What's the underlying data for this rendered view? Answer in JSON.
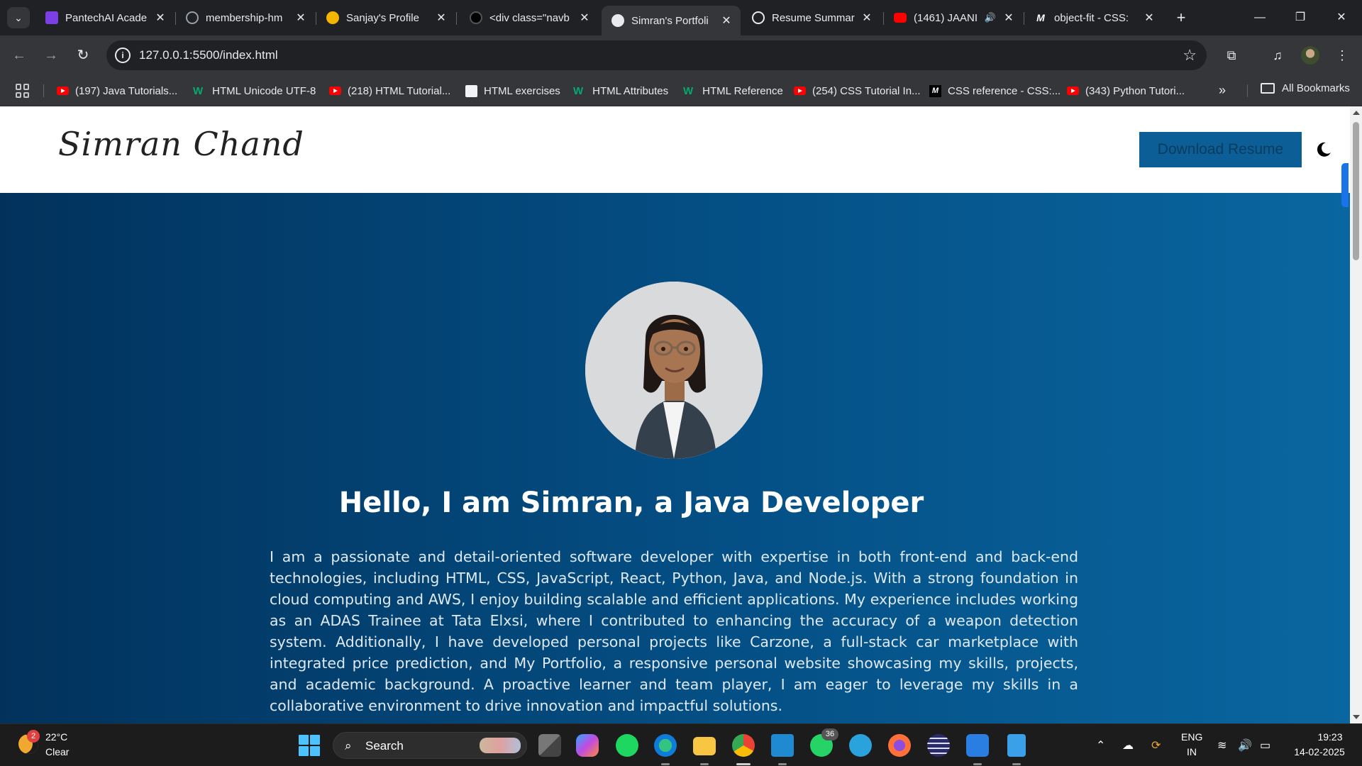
{
  "browser": {
    "tabs": [
      {
        "title": "PantechAI Acade",
        "fav_color": "#7b3fe4"
      },
      {
        "title": "membership-hm",
        "fav_color": "#9aa0a6"
      },
      {
        "title": "Sanjay's Profile",
        "fav_color": "#f4b400"
      },
      {
        "title": "<div class=\"navb",
        "fav_color": "#444444"
      },
      {
        "title": "Simran's Portfoli",
        "fav_color": "#e8eaed"
      },
      {
        "title": "Resume Summar",
        "fav_color": "#e8eaed"
      },
      {
        "title": "(1461) JAANI",
        "fav_color": "#ff0000"
      },
      {
        "title": "object-fit - CSS:",
        "fav_color": "#ffffff"
      }
    ],
    "active_tab_index": 4,
    "url": "127.0.0.1:5500/index.html",
    "bookmarks": [
      {
        "label": "(197) Java Tutorials...",
        "icon": "youtube-icon"
      },
      {
        "label": "HTML Unicode UTF-8",
        "icon": "w3schools-icon"
      },
      {
        "label": "(218) HTML Tutorial...",
        "icon": "youtube-icon"
      },
      {
        "label": "HTML exercises",
        "icon": "exercise-icon"
      },
      {
        "label": "HTML Attributes",
        "icon": "w3schools-icon"
      },
      {
        "label": "HTML Reference",
        "icon": "w3schools-icon"
      },
      {
        "label": "(254) CSS Tutorial In...",
        "icon": "youtube-icon"
      },
      {
        "label": "CSS reference - CSS:...",
        "icon": "mdn-icon"
      },
      {
        "label": "(343) Python Tutori...",
        "icon": "youtube-icon"
      }
    ],
    "all_bookmarks_label": "All Bookmarks"
  },
  "site": {
    "logo": "Simran Chand",
    "download_button": "Download Resume",
    "hero_title": "Hello, I am Simran, a Java Developer",
    "hero_bio": "I am a passionate and detail-oriented software developer with expertise in both front-end and back-end technologies, including HTML, CSS, JavaScript, React, Python, Java, and Node.js. With a strong foundation in cloud computing and AWS, I enjoy building scalable and efficient applications. My experience includes working as an ADAS Trainee at Tata Elxsi, where I contributed to enhancing the accuracy of a weapon detection system. Additionally, I have developed personal projects like Carzone, a full-stack car marketplace with integrated price prediction, and My Portfolio, a responsive personal website showcasing my skills, projects, and academic background. A proactive learner and team player, I am eager to leverage my skills in a collaborative environment to drive innovation and impactful solutions.",
    "accent_color": "#0b5f96"
  },
  "taskbar": {
    "weather_temp": "22°C",
    "weather_status": "Clear",
    "weather_badge": "2",
    "search_label": "Search",
    "whatsapp_badge": "36",
    "lang_top": "ENG",
    "lang_bottom": "IN",
    "time": "19:23",
    "date": "14-02-2025"
  }
}
